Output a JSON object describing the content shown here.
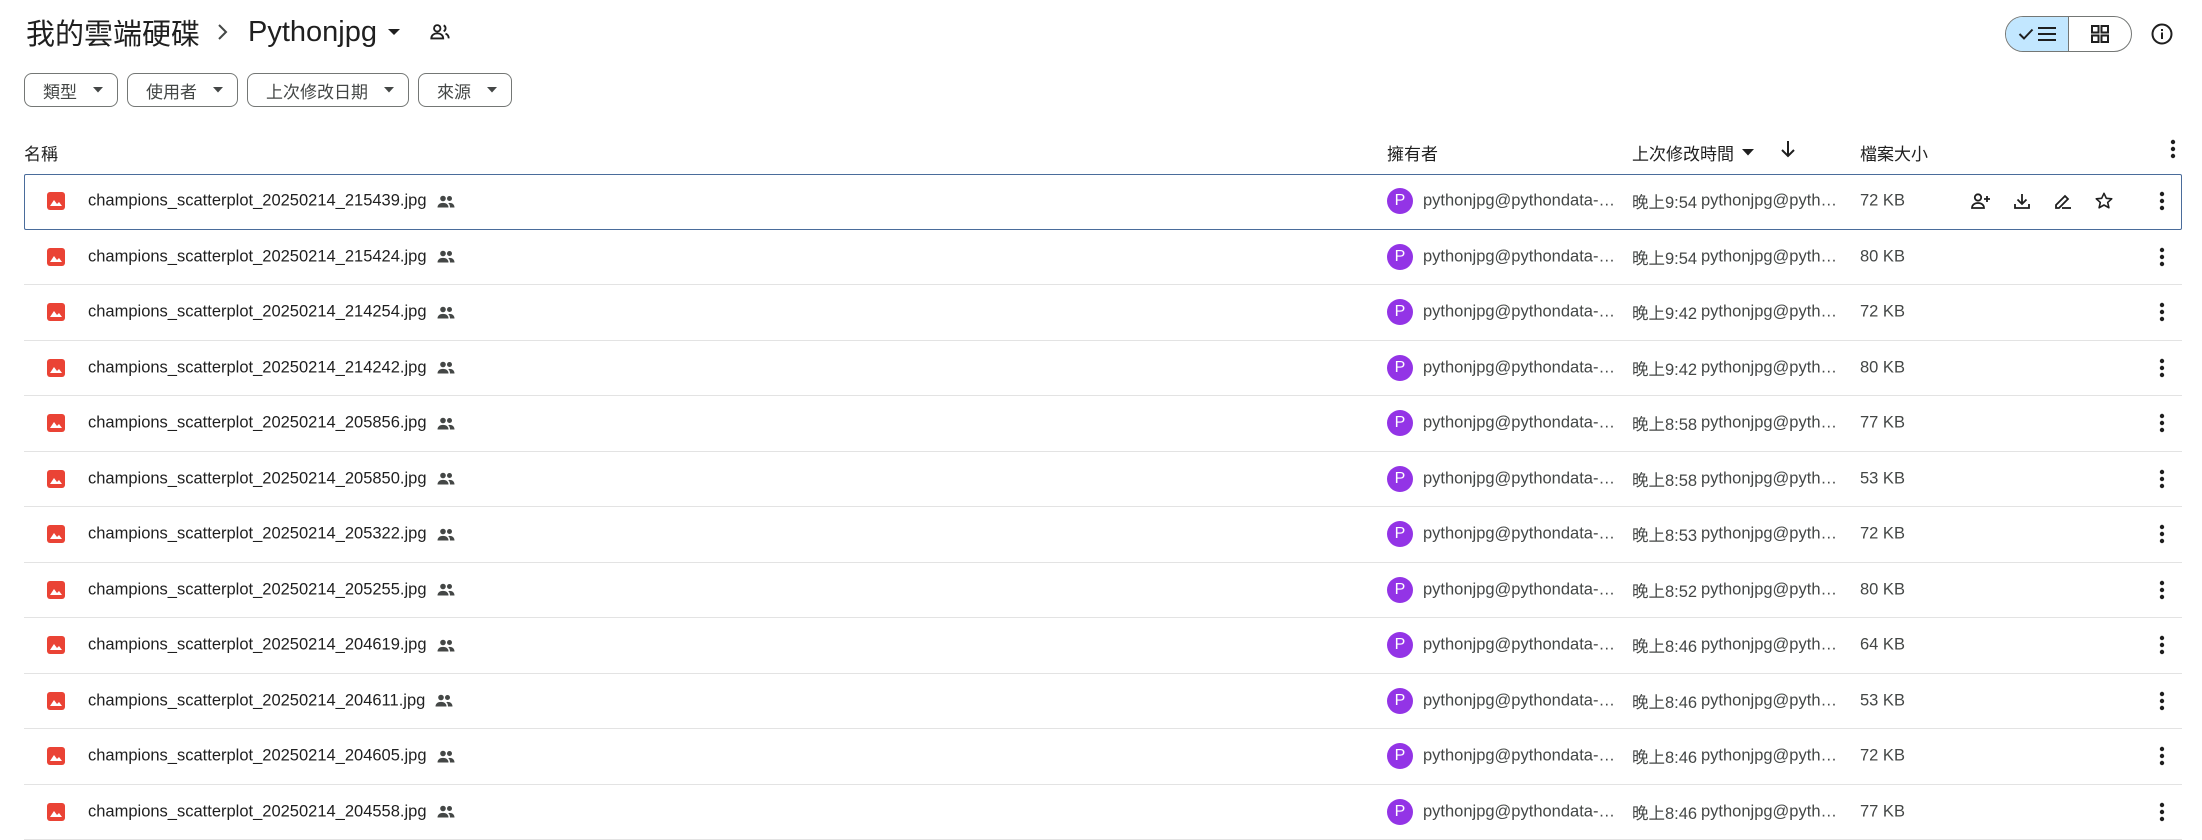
{
  "breadcrumb": {
    "root": "我的雲端硬碟",
    "current": "Pythonjpg"
  },
  "filters": [
    {
      "label": "類型"
    },
    {
      "label": "使用者"
    },
    {
      "label": "上次修改日期"
    },
    {
      "label": "來源"
    }
  ],
  "columns": {
    "name": "名稱",
    "owner": "擁有者",
    "modified": "上次修改時間",
    "size": "檔案大小"
  },
  "owner_initial": "P",
  "rows": [
    {
      "name": "champions_scatterplot_20250214_215439.jpg",
      "owner": "pythonjpg@pythondata-analysis.iam.gserviceaccount.com",
      "time": "晚上9:54",
      "modified_by": "pythonjpg@pythondata",
      "size": "72 KB"
    },
    {
      "name": "champions_scatterplot_20250214_215424.jpg",
      "owner": "pythonjpg@pythondata-analysis.iam.gserviceaccount.com",
      "time": "晚上9:54",
      "modified_by": "pythonjpg@pythondata",
      "size": "80 KB"
    },
    {
      "name": "champions_scatterplot_20250214_214254.jpg",
      "owner": "pythonjpg@pythondata-analysis.iam.gserviceaccount.com",
      "time": "晚上9:42",
      "modified_by": "pythonjpg@pythondata",
      "size": "72 KB"
    },
    {
      "name": "champions_scatterplot_20250214_214242.jpg",
      "owner": "pythonjpg@pythondata-analysis.iam.gserviceaccount.com",
      "time": "晚上9:42",
      "modified_by": "pythonjpg@pythondata",
      "size": "80 KB"
    },
    {
      "name": "champions_scatterplot_20250214_205856.jpg",
      "owner": "pythonjpg@pythondata-analysis.iam.gserviceaccount.com",
      "time": "晚上8:58",
      "modified_by": "pythonjpg@pythondata",
      "size": "77 KB"
    },
    {
      "name": "champions_scatterplot_20250214_205850.jpg",
      "owner": "pythonjpg@pythondata-analysis.iam.gserviceaccount.com",
      "time": "晚上8:58",
      "modified_by": "pythonjpg@pythondata",
      "size": "53 KB"
    },
    {
      "name": "champions_scatterplot_20250214_205322.jpg",
      "owner": "pythonjpg@pythondata-analysis.iam.gserviceaccount.com",
      "time": "晚上8:53",
      "modified_by": "pythonjpg@pythondata",
      "size": "72 KB"
    },
    {
      "name": "champions_scatterplot_20250214_205255.jpg",
      "owner": "pythonjpg@pythondata-analysis.iam.gserviceaccount.com",
      "time": "晚上8:52",
      "modified_by": "pythonjpg@pythondata",
      "size": "80 KB"
    },
    {
      "name": "champions_scatterplot_20250214_204619.jpg",
      "owner": "pythonjpg@pythondata-analysis.iam.gserviceaccount.com",
      "time": "晚上8:46",
      "modified_by": "pythonjpg@pythondata",
      "size": "64 KB"
    },
    {
      "name": "champions_scatterplot_20250214_204611.jpg",
      "owner": "pythonjpg@pythondata-analysis.iam.gserviceaccount.com",
      "time": "晚上8:46",
      "modified_by": "pythonjpg@pythondata",
      "size": "53 KB"
    },
    {
      "name": "champions_scatterplot_20250214_204605.jpg",
      "owner": "pythonjpg@pythondata-analysis.iam.gserviceaccount.com",
      "time": "晚上8:46",
      "modified_by": "pythonjpg@pythondata",
      "size": "72 KB"
    },
    {
      "name": "champions_scatterplot_20250214_204558.jpg",
      "owner": "pythonjpg@pythondata-analysis.iam.gserviceaccount.com",
      "time": "晚上8:46",
      "modified_by": "pythonjpg@pythondata",
      "size": "77 KB"
    }
  ],
  "icons": {
    "file_type": "image-file-icon",
    "shared": "people-icon",
    "row_actions": [
      "share-icon",
      "download-icon",
      "rename-icon",
      "star-icon"
    ],
    "more": "more-vert-icon"
  },
  "colors": {
    "image_file": "#ea4335",
    "avatar": "#9334e6",
    "view_toggle_active": "#c2e7ff",
    "selected_row_border": "#4a6c9b"
  }
}
